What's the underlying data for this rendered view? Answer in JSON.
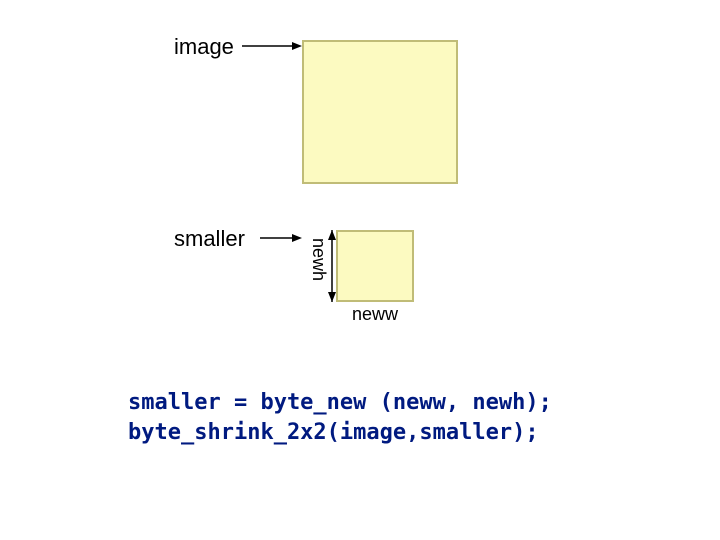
{
  "labels": {
    "image": "image",
    "smaller": "smaller",
    "newh": "newh",
    "neww": "neww"
  },
  "code": {
    "line1": "smaller = byte_new (neww, newh);",
    "line2": "byte_shrink_2x2(image,smaller);"
  }
}
